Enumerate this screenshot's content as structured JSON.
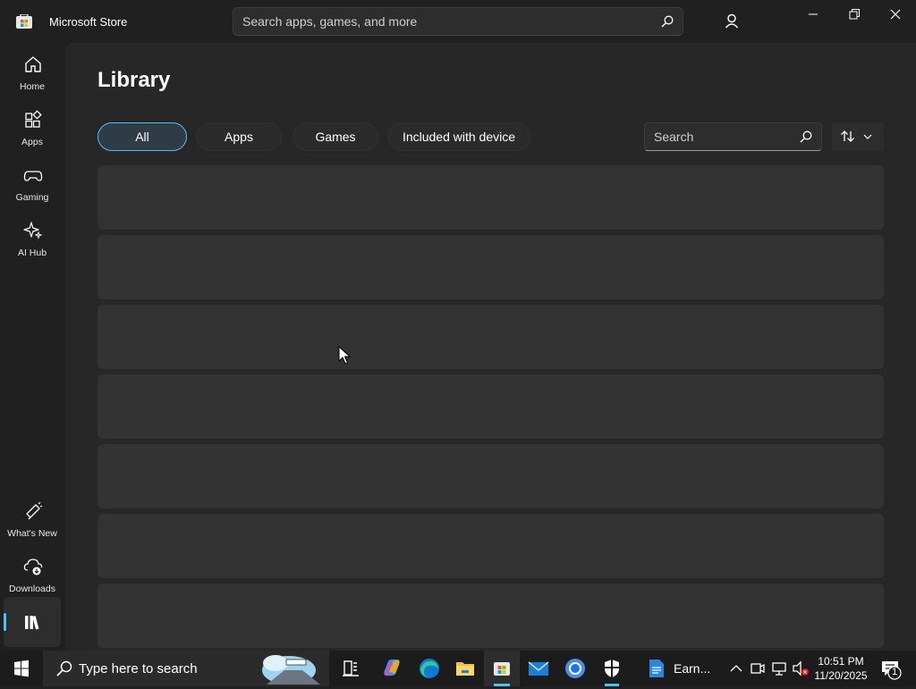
{
  "window": {
    "app_title": "Microsoft Store",
    "search_placeholder": "Search apps, games, and more"
  },
  "nav": {
    "items": [
      {
        "label": "Home",
        "icon": "home-icon"
      },
      {
        "label": "Apps",
        "icon": "apps-icon"
      },
      {
        "label": "Gaming",
        "icon": "gamepad-icon"
      },
      {
        "label": "AI Hub",
        "icon": "sparkle-icon"
      }
    ],
    "bottom_items": [
      {
        "label": "What's New",
        "icon": "megaphone-icon"
      },
      {
        "label": "Downloads",
        "icon": "cloud-download-icon"
      },
      {
        "icon": "library-icon",
        "active": true
      }
    ]
  },
  "library": {
    "title": "Library",
    "filters": [
      {
        "label": "All",
        "selected": true
      },
      {
        "label": "Apps",
        "selected": false
      },
      {
        "label": "Games",
        "selected": false
      },
      {
        "label": "Included with device",
        "selected": false
      }
    ],
    "search_placeholder": "Search",
    "sort_icon": "sort-arrows-icon",
    "row_count": 7
  },
  "taskbar": {
    "search_text": "Type here to search",
    "pinned": [
      "task-view-icon",
      "copilot-icon",
      "edge-icon",
      "file-explorer-icon",
      "store-icon",
      "mail-icon",
      "chrome-icon",
      "security-icon"
    ],
    "open_app_label": "Earn...",
    "time": "10:51 PM",
    "date": "11/20/2025",
    "notification_count": "1"
  },
  "colors": {
    "accent": "#4cc2ff",
    "background": "#202020",
    "content": "#272727",
    "card": "#333333"
  }
}
